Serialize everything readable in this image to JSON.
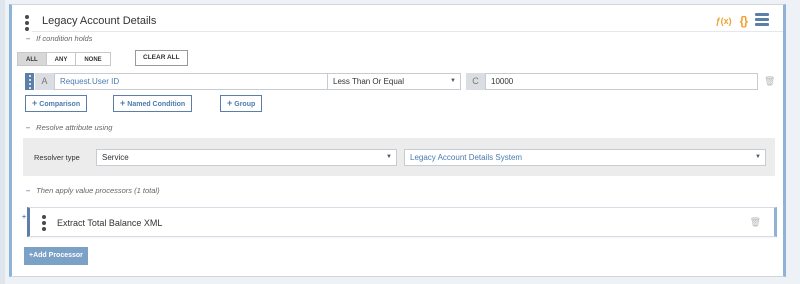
{
  "card": {
    "title": "Legacy Account Details",
    "fn_icon_text": "ƒ(x)",
    "braces_icon_text": "{}"
  },
  "condition": {
    "section_label": "If condition holds",
    "match_buttons": [
      "ALL",
      "ANY",
      "NONE"
    ],
    "active_match": "ALL",
    "clear_all_label": "CLEAR ALL",
    "left_letter": "A",
    "attribute": "Request.User ID",
    "operator": "Less Than Or Equal",
    "right_letter": "C",
    "value": "10000"
  },
  "add_buttons": {
    "comparison": "Comparison",
    "named_condition": "Named Condition",
    "group": "Group"
  },
  "resolver": {
    "section_label": "Resolve attribute using",
    "type_label": "Resolver type",
    "type_value": "Service",
    "system_value": "Legacy Account Details System"
  },
  "processors": {
    "section_label": "Then apply value processors (1 total)",
    "items": [
      {
        "title": "Extract Total Balance XML"
      }
    ],
    "add_label": "Add Processor"
  },
  "colors": {
    "accent": "#5b7fa8",
    "link": "#4a7bb0",
    "warning_icon": "#f0a030"
  }
}
